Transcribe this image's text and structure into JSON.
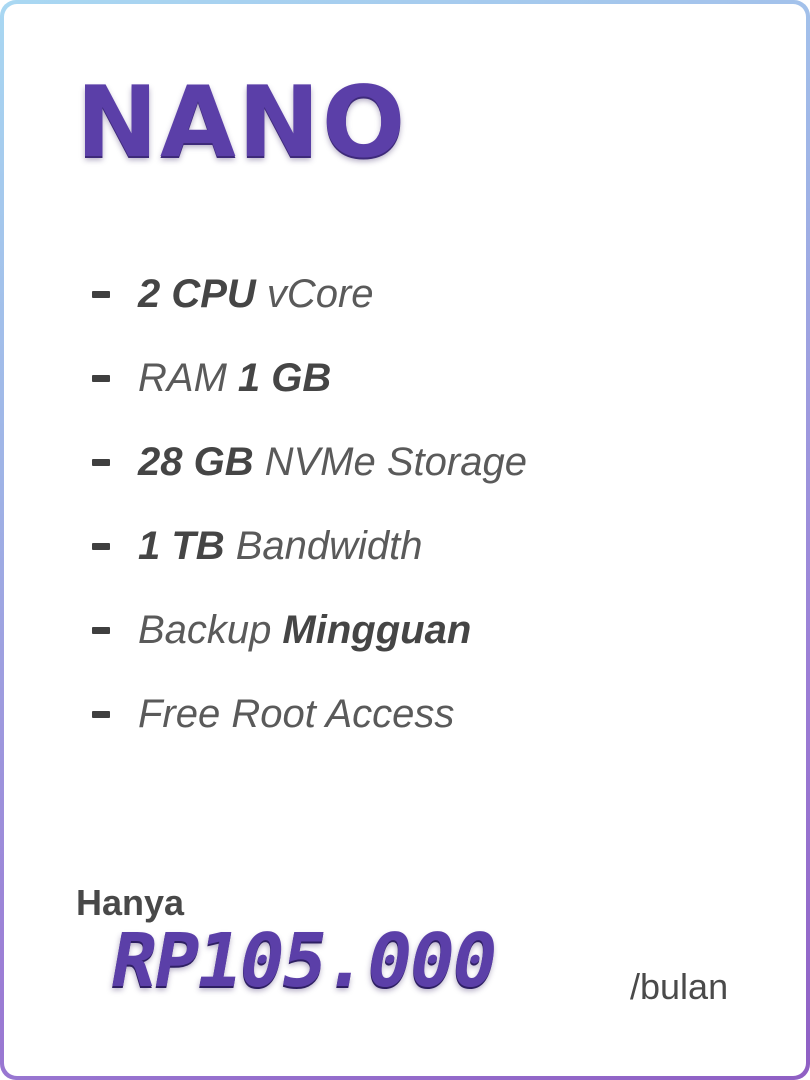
{
  "plan": {
    "name": "NANO"
  },
  "features": [
    {
      "bold": "2 CPU",
      "light": "vCore"
    },
    {
      "light": "RAM",
      "bold": "1 GB"
    },
    {
      "bold": "28 GB",
      "light": "NVMe Storage"
    },
    {
      "bold": "1 TB",
      "light": "Bandwidth"
    },
    {
      "light": "Backup",
      "bold": "Mingguan"
    },
    {
      "light": "Free Root Access"
    }
  ],
  "price": {
    "lead": "Hanya",
    "amount": "RP105.000",
    "period": "/bulan"
  },
  "colors": {
    "accent": "#5b3fa8",
    "text": "#4a4a4a",
    "border_gradient_start": "#a9d8f2",
    "border_gradient_end": "#8f5fc4"
  }
}
